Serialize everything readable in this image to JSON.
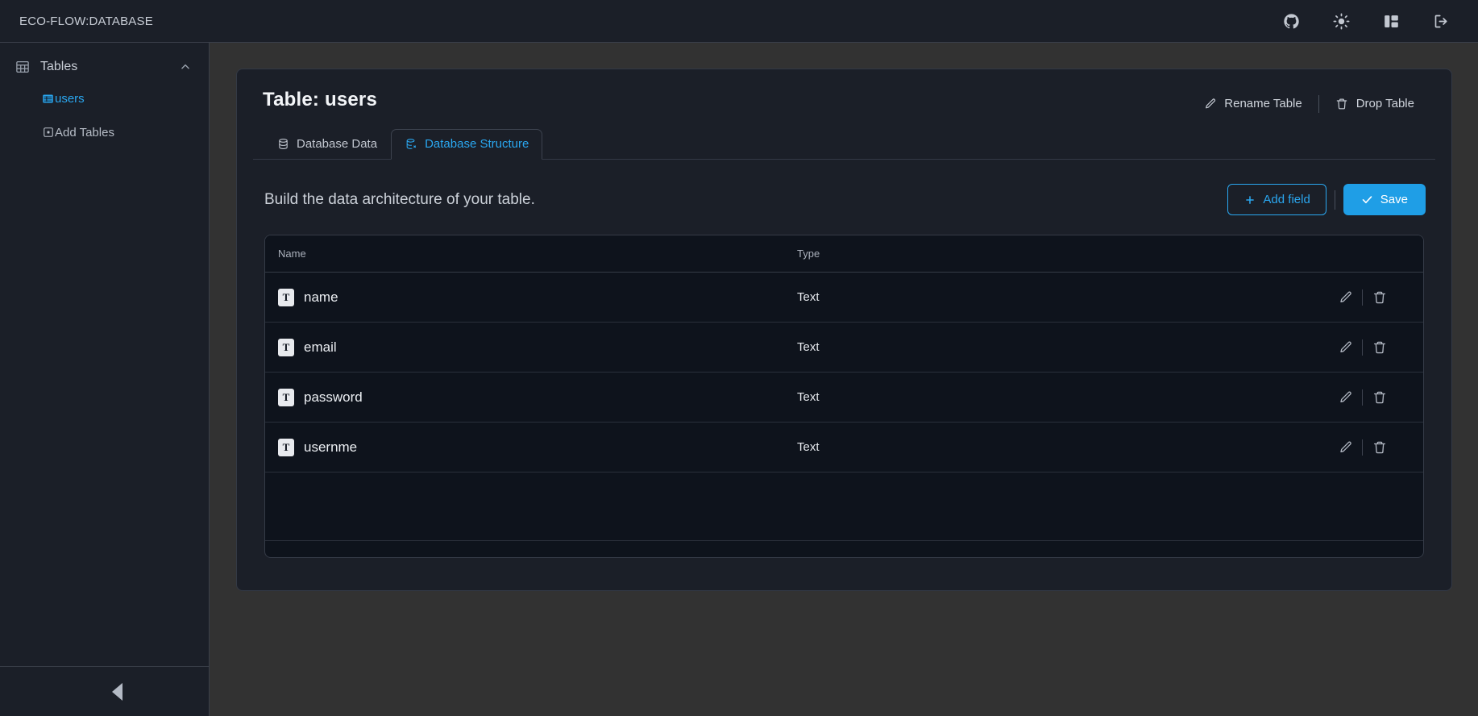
{
  "topbar": {
    "brand": "ECO-FLOW:DATABASE",
    "icons": [
      {
        "name": "github-icon",
        "label": "GitHub"
      },
      {
        "name": "sun-icon",
        "label": "Toggle theme"
      },
      {
        "name": "layout-panel-icon",
        "label": "Toggle panel"
      },
      {
        "name": "logout-icon",
        "label": "Log out"
      }
    ]
  },
  "sidebar": {
    "section": {
      "label": "Tables",
      "icon": "table-icon",
      "chevron": "chevron-up-icon"
    },
    "items": [
      {
        "label": "users",
        "icon": "table-small-icon",
        "active": true
      },
      {
        "label": "Add Tables",
        "icon": "add-square-icon",
        "active": false
      }
    ],
    "collapse_label": "Collapse sidebar"
  },
  "card": {
    "title": "Table: users",
    "actions": [
      {
        "label": "Rename Table",
        "icon": "pencil-icon"
      },
      {
        "label": "Drop Table",
        "icon": "trash-icon"
      }
    ],
    "tabs": [
      {
        "label": "Database Data",
        "icon": "database-icon",
        "active": false
      },
      {
        "label": "Database Structure",
        "icon": "database-structure-icon",
        "active": true
      }
    ],
    "builder": {
      "description": "Build the data architecture of your table.",
      "add_field_label": "Add field",
      "add_field_icon": "plus-icon",
      "save_label": "Save",
      "save_icon": "check-icon"
    },
    "fields_table": {
      "columns": [
        "Name",
        "Type"
      ],
      "rows": [
        {
          "badge": "T",
          "name": "name",
          "type": "Text"
        },
        {
          "badge": "T",
          "name": "email",
          "type": "Text"
        },
        {
          "badge": "T",
          "name": "password",
          "type": "Text"
        },
        {
          "badge": "T",
          "name": "usernme",
          "type": "Text"
        }
      ],
      "row_actions": [
        {
          "name": "edit-field-icon",
          "label": "Edit field"
        },
        {
          "name": "delete-field-icon",
          "label": "Delete field"
        }
      ]
    }
  },
  "colors": {
    "accent": "#2aa7f0",
    "save_button": "#1f9ee6",
    "panel_bg": "#1b1f28",
    "table_bg": "#0e131c",
    "page_bg": "#323232"
  }
}
